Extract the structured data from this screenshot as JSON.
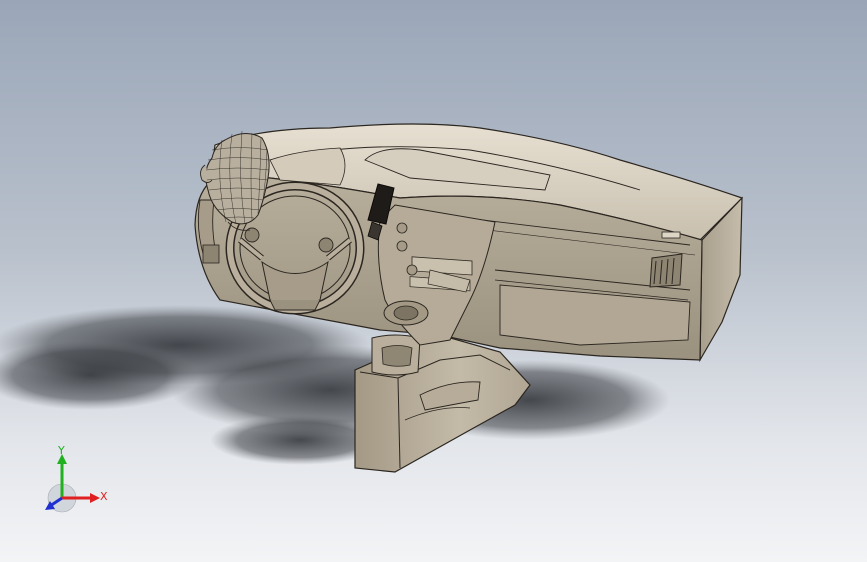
{
  "viewport": {
    "background_top": "#9aa6b8",
    "background_bottom": "#f3f4f6",
    "model_color": "#cdc4b4"
  },
  "triad": {
    "x_label": "X",
    "y_label": "Y",
    "x_color": "#e02020",
    "y_color": "#20b020",
    "z_color": "#2030d0"
  },
  "model": {
    "parts": [
      "dashboard",
      "steering-wheel",
      "mannequin-head",
      "phone-mount",
      "center-console",
      "air-vent",
      "glovebox",
      "shadow"
    ]
  }
}
